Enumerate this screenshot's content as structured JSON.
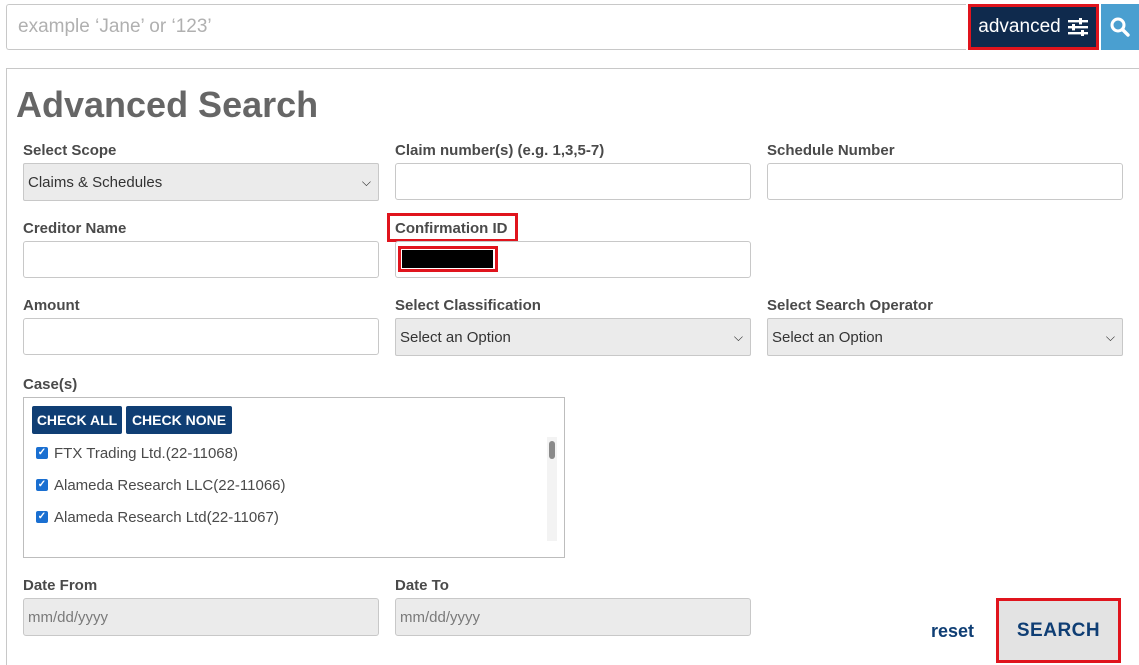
{
  "top_search": {
    "placeholder": "example ‘Jane’ or ‘123’",
    "advanced_label": "advanced",
    "advanced_icon": "sliders-icon",
    "search_icon": "magnifier-icon"
  },
  "title": "Advanced Search",
  "fields": {
    "scope": {
      "label": "Select Scope",
      "value": "Claims & Schedules"
    },
    "claim_numbers": {
      "label": "Claim number(s) (e.g. 1,3,5-7)",
      "value": ""
    },
    "schedule_number": {
      "label": "Schedule Number",
      "value": ""
    },
    "creditor_name": {
      "label": "Creditor Name",
      "value": ""
    },
    "confirmation_id": {
      "label": "Confirmation ID",
      "value": ""
    },
    "amount": {
      "label": "Amount",
      "value": ""
    },
    "classification": {
      "label": "Select Classification",
      "value": "Select an Option"
    },
    "search_operator": {
      "label": "Select Search Operator",
      "value": "Select an Option"
    },
    "date_from": {
      "label": "Date From",
      "placeholder": "mm/dd/yyyy"
    },
    "date_to": {
      "label": "Date To",
      "placeholder": "mm/dd/yyyy"
    }
  },
  "cases": {
    "label": "Case(s)",
    "check_all": "CHECK ALL",
    "check_none": "CHECK NONE",
    "items": [
      {
        "label": "FTX Trading Ltd.(22-11068)",
        "checked": true
      },
      {
        "label": "Alameda Research LLC(22-11066)",
        "checked": true
      },
      {
        "label": "Alameda Research Ltd(22-11067)",
        "checked": true
      }
    ]
  },
  "actions": {
    "reset": "reset",
    "search": "SEARCH"
  },
  "colors": {
    "navy": "#0f2a4d",
    "accent_blue": "#4a9fd0",
    "highlight_red": "#e0141d",
    "button_blue": "#0f3e74"
  }
}
